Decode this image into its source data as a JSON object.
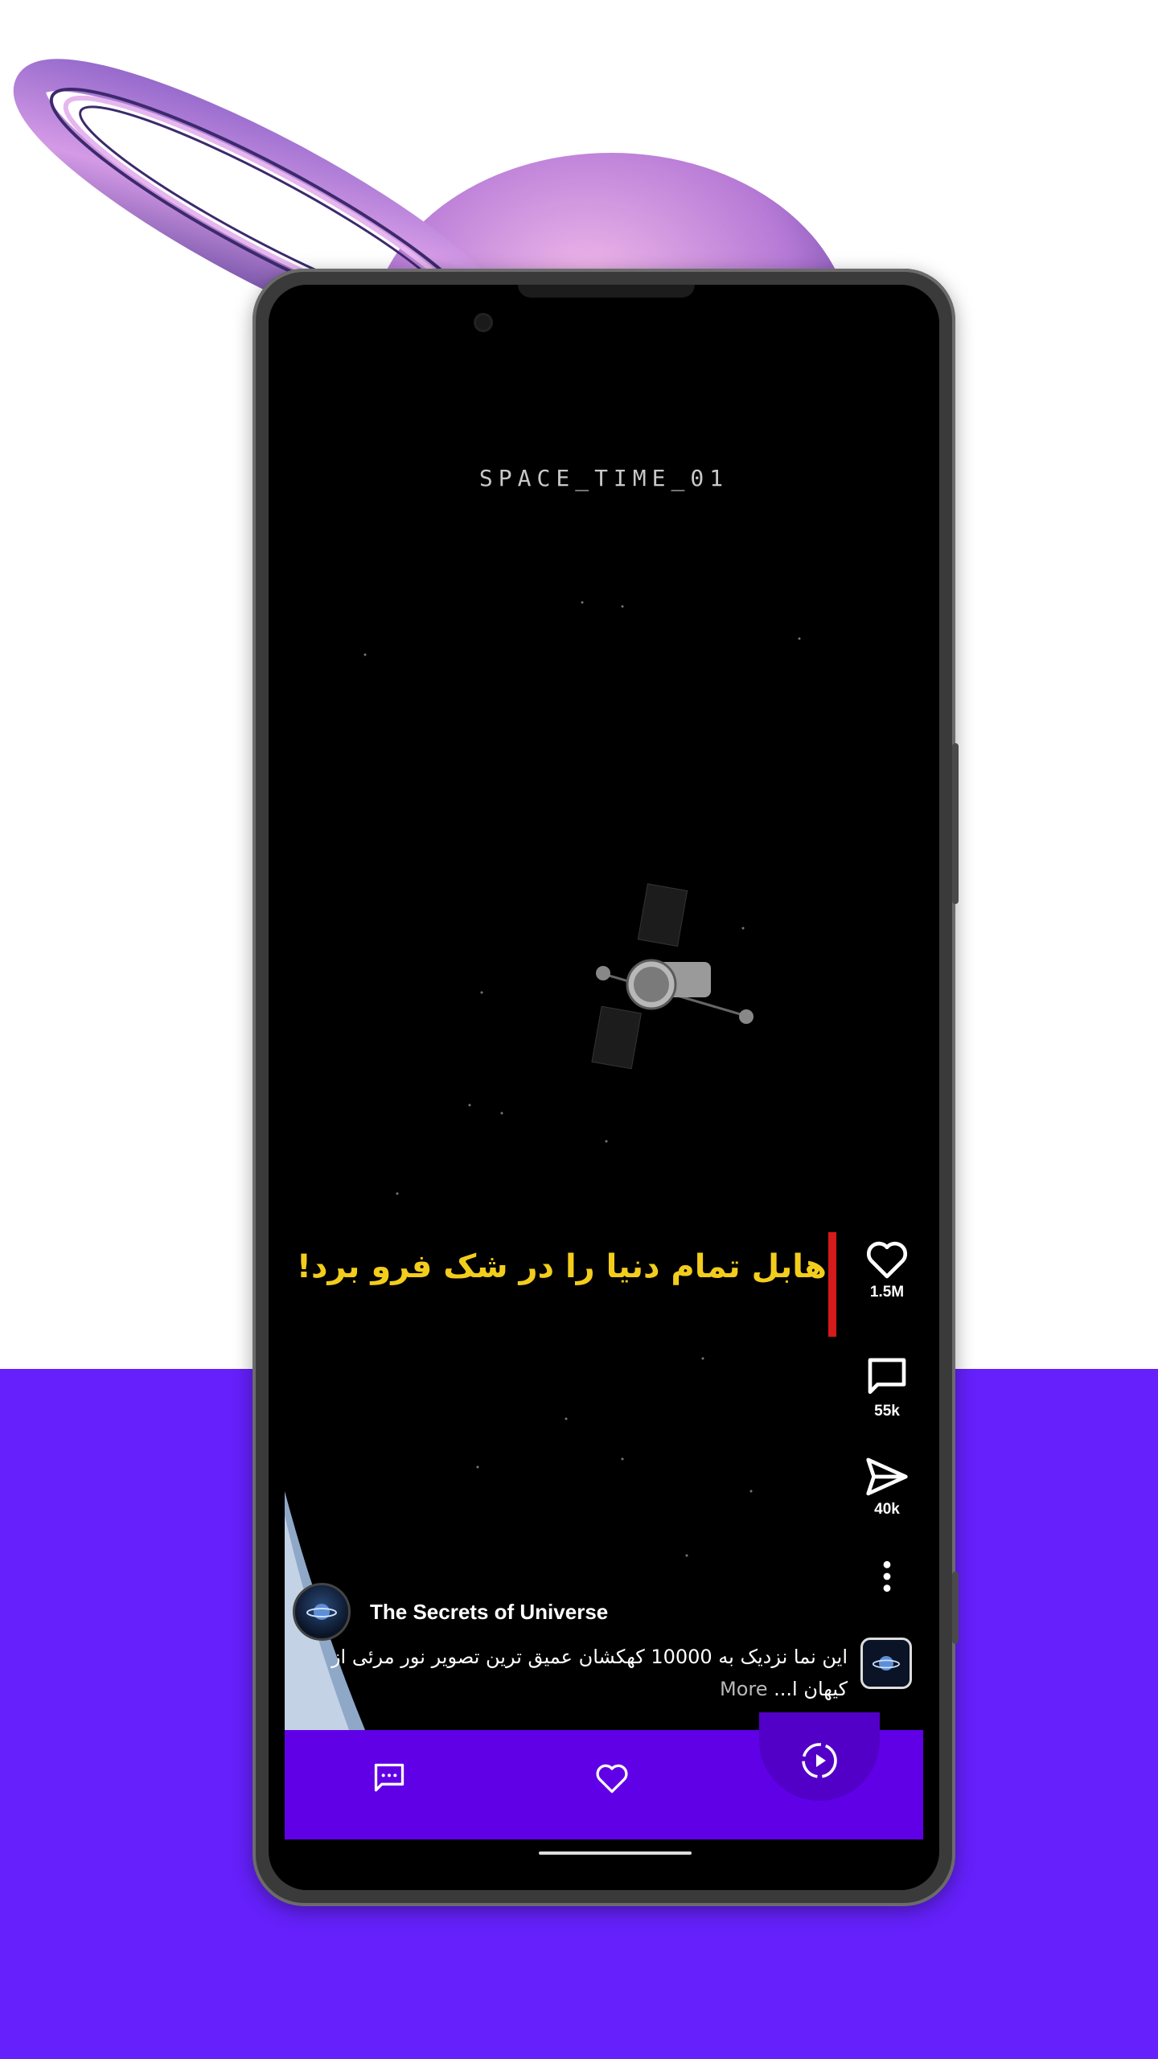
{
  "video": {
    "title_code": "SPACE_TIME_01",
    "caption": "هابل تمام دنیا را در شک فرو برد!"
  },
  "actions": {
    "like_count": "1.5M",
    "comment_count": "55k",
    "share_count": "40k"
  },
  "channel": {
    "name": "The Secrets of Universe"
  },
  "description": {
    "line1": "این نما نزدیک به 10000 کهکشان عمیق ترین تصویر نور مرئی از",
    "line2": "کیهان ا...",
    "more_label": "More"
  },
  "colors": {
    "accent": "#6520fb",
    "navbar": "#6000e6",
    "caption": "#f3cd1c",
    "red_bar": "#d51a1a"
  },
  "icons": {
    "like": "heart-icon",
    "comment": "comment-icon",
    "share": "send-icon",
    "more": "more-vertical-icon",
    "nav_messages": "chat-icon",
    "nav_likes": "heart-icon",
    "nav_reels": "play-circle-icon"
  }
}
